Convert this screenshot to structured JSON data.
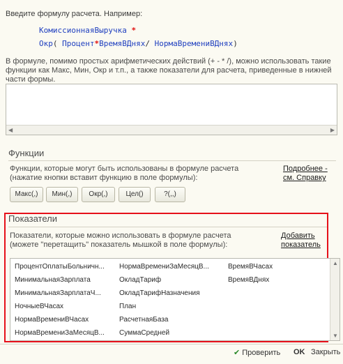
{
  "intro": "Введите формулу расчета. Например:",
  "example": {
    "line1_name": "КомиссионнаяВыручка",
    "star": "*",
    "line2_prefix": "Окр",
    "paren_open": "(",
    "percent": "Процент",
    "time_days": "ВремяВДнях",
    "slash": "/",
    "norm_time_days": "НормаВремениВДнях",
    "paren_close": ")"
  },
  "description": "В формуле, помимо простых арифметических действий (+ - * /), можно использовать такие функции как Макс, Мин, Окр и т.п., а также показатели для расчета, приведенные в нижней части формы.",
  "formula_value": "",
  "functions": {
    "title": "Функции",
    "desc_line1": "Функции, которые могут быть использованы в формуле расчета",
    "desc_line2": "(нажатие кнопки вставит функцию в поле формулы):",
    "help_link_line1": "Подробнее -",
    "help_link_line2": "см. Справку",
    "buttons": [
      "Макс(,)",
      "Мин(,)",
      "Окр(,)",
      "Цел()",
      "?(,,)"
    ]
  },
  "indicators": {
    "title": "Показатели",
    "desc_line1": "Показатели, которые можно использовать в формуле расчета",
    "desc_line2": "(можете \"перетащить\" показатель мышкой в поле формулы):",
    "add_link_line1": "Добавить",
    "add_link_line2": "показатель",
    "col1": [
      "ПроцентОплатыБольничн...",
      "МинимальнаяЗарплата",
      "МинимальнаяЗарплатаЧ...",
      "НочныеВЧасах",
      "НормаВремениВЧасах",
      "НормаВремениЗаМесяцВ..."
    ],
    "col2": [
      "НормаВремениЗаМесяцВ...",
      "ОкладТариф",
      "ОкладТарифНазначения",
      "План",
      "РасчетнаяБаза",
      "СуммаСредней"
    ],
    "col3": [
      "ВремяВЧасах",
      "ВремяВДнях"
    ]
  },
  "footer": {
    "check_label": "Проверить",
    "ok_label": "OK",
    "close_label": "Закрыть"
  }
}
